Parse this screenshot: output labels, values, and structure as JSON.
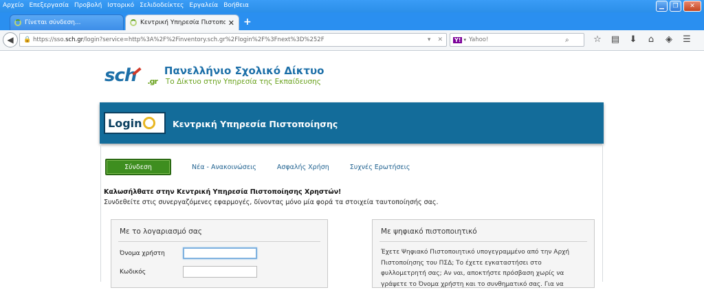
{
  "browser": {
    "menu": [
      "Αρχείο",
      "Επεξεργασία",
      "Προβολή",
      "Ιστορικό",
      "Σελιδοδείκτες",
      "Εργαλεία",
      "Βοήθεια"
    ],
    "tabs": [
      {
        "label": "Γίνεται σύνδεση..."
      },
      {
        "label": "Κεντρική Υπηρεσία Πιστοποίησ..."
      }
    ],
    "url_prefix": "https://sso.",
    "url_host": "sch.gr",
    "url_rest": "/login?service=http%3A%2F%2Finventory.sch.gr%2Flogin%2F%3Fnext%3D%252F",
    "search_engine": "Y!",
    "search_placeholder": "Yahoo!",
    "icons": [
      "star-icon",
      "clipboard-icon",
      "download-icon",
      "home-icon",
      "extension-icon",
      "menu-icon"
    ]
  },
  "site": {
    "logo_text": "sch",
    "logo_suffix": ".gr",
    "title": "Πανελλήνιο Σχολικό Δίκτυο",
    "subtitle": "Το Δίκτυο στην Υπηρεσία της Εκπαίδευσης"
  },
  "banner": {
    "badge": "Login",
    "title": "Κεντρική Υπηρεσία Πιστοποίησης"
  },
  "nav": {
    "login": "Σύνδεση",
    "links": [
      "Νέα - Ανακοινώσεις",
      "Ασφαλής Χρήση",
      "Συχνές Ερωτήσεις"
    ]
  },
  "welcome": {
    "heading": "Καλωσήλθατε στην Κεντρική Υπηρεσία Πιστοποίησης Χρηστών!",
    "text": "Συνδεθείτε στις συνεργαζόμενες εφαρμογές, δίνοντας μόνο μία φορά τα στοιχεία ταυτοποίησής σας."
  },
  "account_panel": {
    "title": "Με το λογαριασμό σας",
    "username_label": "Όνομα χρήστη",
    "username_value": "",
    "password_label": "Κωδικός",
    "password_value": ""
  },
  "cert_panel": {
    "title": "Με ψηφιακό πιστοποιητικό",
    "text": "Έχετε Ψηφιακό Πιστοποιητικό υπογεγραμμένο από την Αρχή Πιστοποίησης του ΠΣΔ; Το έχετε εγκαταστήσει στο φυλλομετρητή σας; Αν ναι, αποκτήστε πρόσβαση χωρίς να γράψετε το Όνομα χρήστη και το συνθηματικό σας. Για να"
  },
  "colors": {
    "banner": "#136c9a",
    "login_button": "#3e8e1f",
    "link": "#1c5f8e",
    "browser_chrome": "#2a8ff0"
  }
}
